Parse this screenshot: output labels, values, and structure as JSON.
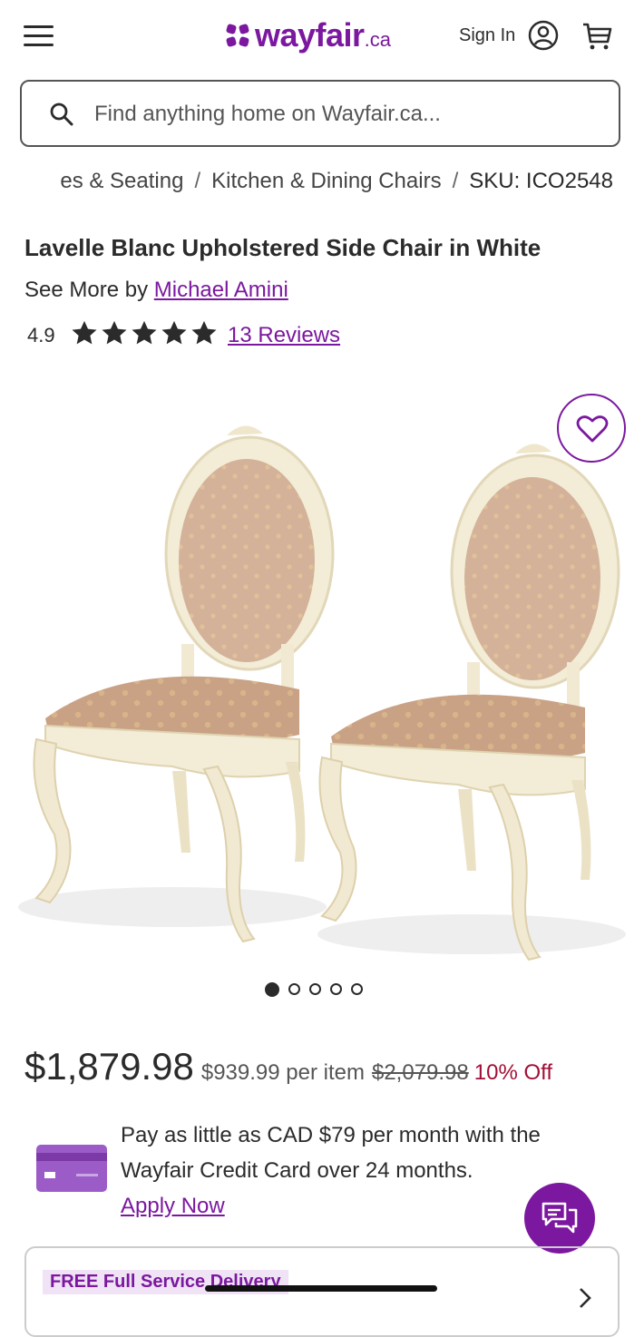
{
  "header": {
    "logo_word": "wayfair",
    "logo_tld": ".ca",
    "sign_in": "Sign In",
    "brand_color": "#7b189f"
  },
  "search": {
    "placeholder": "Find anything home on Wayfair.ca..."
  },
  "breadcrumb": {
    "items": [
      "es & Seating",
      "Kitchen & Dining Chairs"
    ],
    "sku": "SKU: ICO2548"
  },
  "product": {
    "title": "Lavelle Blanc Upholstered Side Chair in White",
    "see_more_prefix": "See More by",
    "brand": "Michael Amini",
    "rating": "4.9",
    "stars": 5,
    "reviews": "13 Reviews"
  },
  "gallery": {
    "total_images": 5,
    "active_index": 0
  },
  "pricing": {
    "price": "$1,879.98",
    "per_item": "$939.99 per item",
    "was_price": "$2,079.98",
    "discount": "10% Off"
  },
  "credit": {
    "text": "Pay as little as CAD $79 per month with the Wayfair Credit Card over 24 months.",
    "apply": "Apply Now"
  },
  "delivery": {
    "badge": "FREE Full Service Delivery"
  }
}
